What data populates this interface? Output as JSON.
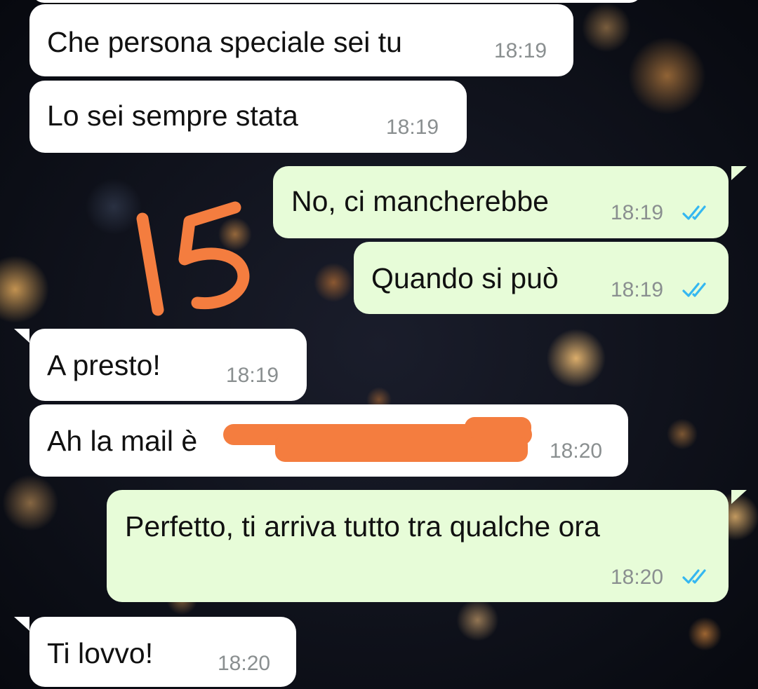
{
  "chat": {
    "messages": [
      {
        "direction": "incoming",
        "text": "Che persona speciale sei tu",
        "time": "18:19"
      },
      {
        "direction": "incoming",
        "text": "Lo sei sempre stata",
        "time": "18:19"
      },
      {
        "direction": "outgoing",
        "text": "No, ci mancherebbe",
        "time": "18:19",
        "status": "read"
      },
      {
        "direction": "outgoing",
        "text": "Quando si può",
        "time": "18:19",
        "status": "read"
      },
      {
        "direction": "incoming",
        "text": "A presto!",
        "time": "18:19"
      },
      {
        "direction": "incoming",
        "text": "Ah la mail è",
        "time": "18:20",
        "redacted": true
      },
      {
        "direction": "outgoing",
        "text": "Perfetto, ti arriva tutto tra qualche ora",
        "time": "18:20",
        "status": "read"
      },
      {
        "direction": "incoming",
        "text": "Ti lovvo!",
        "time": "18:20"
      }
    ]
  },
  "annotation": {
    "handwritten_text": "15",
    "color": "#f47d3f"
  },
  "colors": {
    "incoming_bubble": "#ffffff",
    "outgoing_bubble": "#e7fcd8",
    "read_ticks": "#34b7f1",
    "redaction": "#f47d3f",
    "timestamp": "#8a8f90"
  },
  "icons": {
    "read_receipt": "double-check-icon"
  }
}
